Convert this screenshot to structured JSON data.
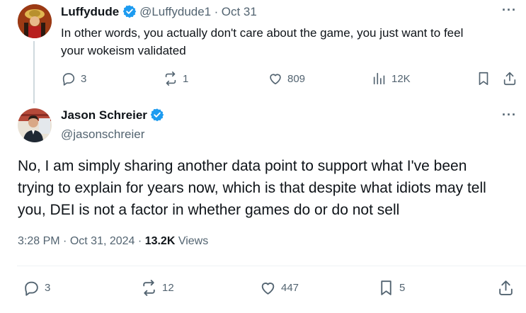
{
  "reply": {
    "display_name": "Luffydude",
    "handle": "@Luffydude1",
    "separator": "·",
    "date": "Oct 31",
    "text": "In other words, you actually don't care about the game, you just want to feel your wokeism validated",
    "actions": {
      "replies": "3",
      "reposts": "1",
      "likes": "809",
      "views": "12K"
    }
  },
  "main": {
    "display_name": "Jason Schreier",
    "handle": "@jasonschreier",
    "text": "No, I am simply sharing another data point to support what I've been trying to explain for years now, which is that despite what idiots may tell you, DEI is not a factor in whether games do or do not sell",
    "time": "3:28 PM",
    "date": "Oct 31, 2024",
    "views_count": "13.2K",
    "views_label": "Views",
    "actions": {
      "replies": "3",
      "reposts": "12",
      "likes": "447",
      "bookmarks": "5"
    }
  },
  "icons": {
    "verified": "verified-badge-icon",
    "more": "more-icon",
    "reply": "reply-icon",
    "repost": "repost-icon",
    "like": "like-icon",
    "views": "views-icon",
    "bookmark": "bookmark-icon",
    "share": "share-icon"
  },
  "colors": {
    "verified": "#1d9bf0",
    "secondary_text": "#536471",
    "primary_text": "#0f1419"
  }
}
